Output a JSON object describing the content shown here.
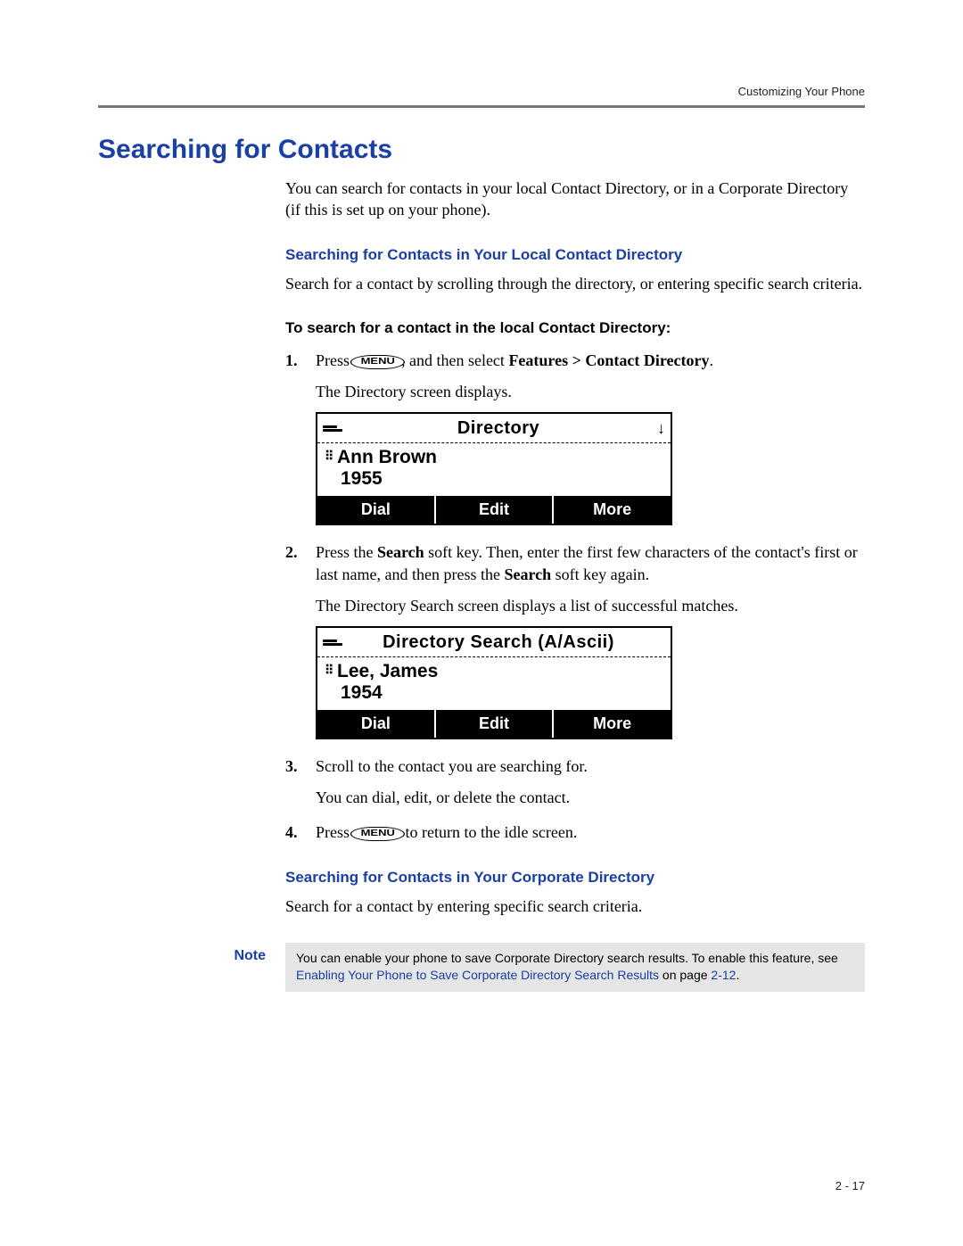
{
  "header": {
    "running": "Customizing Your Phone"
  },
  "title": "Searching for Contacts",
  "intro": "You can search for contacts in your local Contact Directory, or in a Corporate Directory (if this is set up on your phone).",
  "sec1": {
    "heading": "Searching for Contacts in Your Local Contact Directory",
    "body": "Search for a contact by scrolling through the directory, or entering specific search criteria.",
    "proc_heading": "To search for a contact in the local Contact Directory:"
  },
  "steps": {
    "s1a_pre": "Press ",
    "s1a_post": ", and then select ",
    "s1a_bold": "Features > Contact Directory",
    "s1a_end": ".",
    "s1b": "The Directory screen displays.",
    "s2a_pre": "Press the ",
    "s2a_b1": "Search",
    "s2a_mid": " soft key. Then, enter the first few characters of the contact's first or last name, and then press the ",
    "s2a_b2": "Search",
    "s2a_post": " soft key again.",
    "s2b": "The Directory Search screen displays a list of successful matches.",
    "s3a": "Scroll to the contact you are searching for.",
    "s3b": "You can dial, edit, or delete the contact.",
    "s4a_pre": "Press ",
    "s4a_post": " to return to the idle screen."
  },
  "menu_key": "MENU",
  "lcd1": {
    "title": "Directory",
    "name": "Ann Brown",
    "number": "1955",
    "soft": [
      "Dial",
      "Edit",
      "More"
    ],
    "arrow": "↓"
  },
  "lcd2": {
    "title": "Directory Search (A/Ascii)",
    "name": "Lee, James",
    "number": "1954",
    "soft": [
      "Dial",
      "Edit",
      "More"
    ],
    "arrow": ""
  },
  "sec2": {
    "heading": "Searching for Contacts in Your Corporate Directory",
    "body": "Search for a contact by entering specific search criteria."
  },
  "note": {
    "label": "Note",
    "text1": "You can enable your phone to save Corporate Directory search results. To enable this feature, see ",
    "link": "Enabling Your Phone to Save Corporate Directory Search Results",
    "text2": " on page ",
    "pageref": "2-12",
    "text3": "."
  },
  "pagenum": "2 - 17"
}
